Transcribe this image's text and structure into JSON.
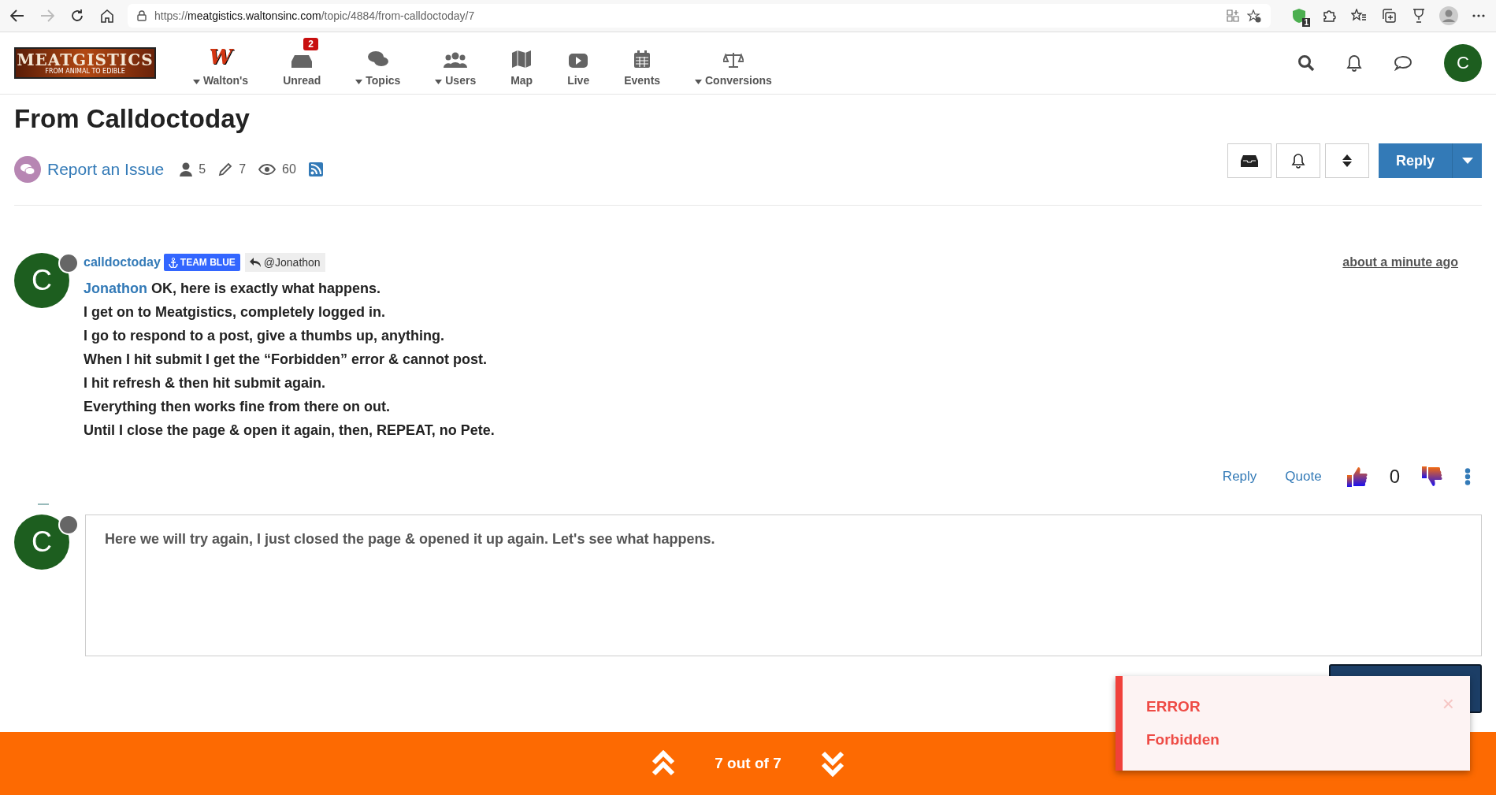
{
  "browser": {
    "url_scheme": "https://",
    "url_host": "meatgistics.waltonsinc.com",
    "url_path": "/topic/4884/from-calldoctoday/7",
    "extension_badge": "1"
  },
  "header": {
    "logo": "MEATGISTICS",
    "logo_tagline": "FROM ANIMAL TO EDIBLE",
    "nav": [
      {
        "kind": "brand",
        "glyph": "W",
        "label": "Walton's",
        "dropdown": true
      },
      {
        "kind": "unread",
        "label": "Unread",
        "dropdown": false,
        "badge": "2"
      },
      {
        "kind": "topics",
        "label": "Topics",
        "dropdown": true
      },
      {
        "kind": "users",
        "label": "Users",
        "dropdown": true
      },
      {
        "kind": "map",
        "label": "Map",
        "dropdown": false
      },
      {
        "kind": "live",
        "label": "Live",
        "dropdown": false
      },
      {
        "kind": "events",
        "label": "Events",
        "dropdown": false
      },
      {
        "kind": "conversions",
        "label": "Conversions",
        "dropdown": true
      }
    ],
    "avatar_letter": "C"
  },
  "topic": {
    "title": "From Calldoctoday",
    "category": "Report an Issue",
    "posters": "5",
    "posts": "7",
    "views": "60",
    "reply_button": "Reply"
  },
  "post": {
    "avatar_letter": "C",
    "author": "calldoctoday",
    "badge": "TEAM BLUE",
    "reply_to": "@Jonathon",
    "time": "about a minute ago",
    "mention": "Jonathon",
    "lines": [
      "OK, here is exactly what happens.",
      "I get on to Meatgistics, completely logged in.",
      "I go to respond to a post, give a thumbs up, anything.",
      "When I hit submit I get the “Forbidden” error & cannot post.",
      "I hit refresh & then hit submit again.",
      "Everything then works fine from there on out.",
      "Until I close the page & open it again, then, REPEAT, no Pete."
    ],
    "actions": [
      "Reply",
      "Quote"
    ],
    "votes": "0"
  },
  "composer": {
    "avatar_letter": "C",
    "value": "Here we will try again, I just closed the page & opened it up again. Let's see what happens."
  },
  "toast": {
    "title": "ERROR",
    "message": "Forbidden",
    "close": "×"
  },
  "pager": {
    "label": "7 out of 7"
  }
}
